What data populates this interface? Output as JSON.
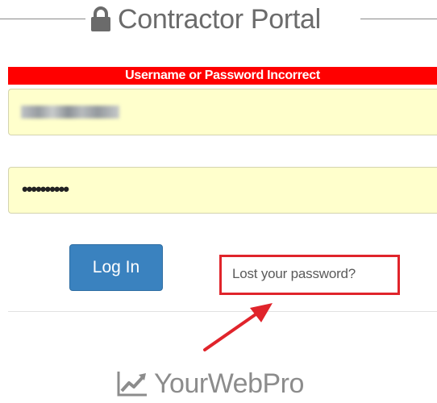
{
  "header": {
    "title": "Contractor Portal",
    "icon": "lock-icon"
  },
  "error": {
    "message": "Username or Password Incorrect",
    "color": "#ff0000"
  },
  "username": {
    "value": "",
    "obscured": true
  },
  "password": {
    "value": "••••••••••"
  },
  "fields": {
    "background_color": "#ffffcc"
  },
  "login_button": {
    "label": "Log In",
    "color": "#3a82bf"
  },
  "lost_password": {
    "label": "Lost your password?",
    "highlight_color": "#e0242b"
  },
  "annotation": {
    "icon": "red-arrow-icon"
  },
  "brand": {
    "name": "YourWebPro",
    "icon": "trend-chart-icon"
  }
}
